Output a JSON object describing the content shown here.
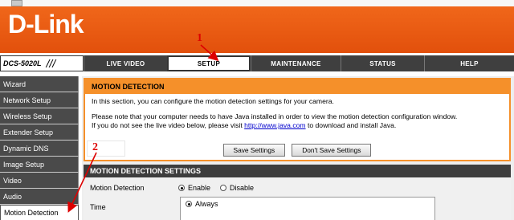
{
  "header": {
    "logo": "D-Link"
  },
  "nav": {
    "model": "DCS-5020L",
    "model_slashes": "///",
    "tabs": [
      "LIVE VIDEO",
      "SETUP",
      "MAINTENANCE",
      "STATUS",
      "HELP"
    ],
    "active_tab": "SETUP"
  },
  "sidebar": {
    "items": [
      {
        "label": "Wizard"
      },
      {
        "label": "Network Setup"
      },
      {
        "label": "Wireless Setup"
      },
      {
        "label": "Extender Setup"
      },
      {
        "label": "Dynamic DNS"
      },
      {
        "label": "Image Setup"
      },
      {
        "label": "Video"
      },
      {
        "label": "Audio"
      },
      {
        "label": "Motion Detection"
      }
    ],
    "active_item": "Motion Detection"
  },
  "motion": {
    "title": "MOTION DETECTION",
    "intro": "In this section, you can configure the motion detection settings for your camera.",
    "java_note_1": "Please note that your computer needs to have Java installed in order to view the motion detection configuration window.",
    "java_note_2_prefix": "If you do not see the live video below, please visit",
    "java_link": "http://www.java.com",
    "java_note_2_suffix": "to download and install Java.",
    "save_button": "Save Settings",
    "dont_save_button": "Don't Save Settings"
  },
  "settings": {
    "title": "MOTION DETECTION SETTINGS",
    "motion_label": "Motion Detection",
    "enable_label": "Enable",
    "disable_label": "Disable",
    "time_label": "Time",
    "always_label": "Always"
  },
  "annotations": {
    "step1": "1",
    "step2": "2"
  },
  "colors": {
    "brand_orange": "#e85a12",
    "box_border": "#f5902a",
    "annotation_red": "#dd0000"
  }
}
